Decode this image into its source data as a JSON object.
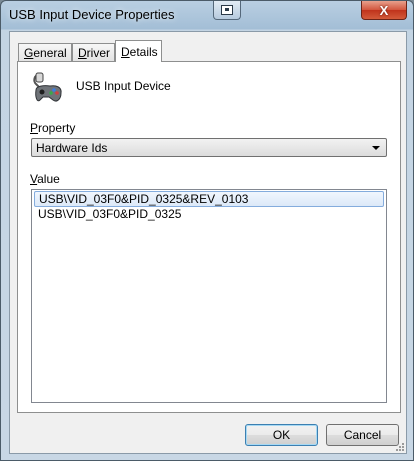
{
  "window": {
    "title": "USB Input Device Properties",
    "close_glyph": "X"
  },
  "tabs": [
    {
      "label": "General",
      "mnemonic_index": 0,
      "active": false
    },
    {
      "label": "Driver",
      "mnemonic_index": 0,
      "active": false
    },
    {
      "label": "Details",
      "mnemonic_index": 0,
      "active": true
    }
  ],
  "device": {
    "name": "USB Input Device",
    "icon": "game-controller-icon"
  },
  "property": {
    "label": "Property",
    "selected": "Hardware Ids"
  },
  "value_list": {
    "label": "Value",
    "items": [
      "USB\\VID_03F0&PID_0325&REV_0103",
      "USB\\VID_03F0&PID_0325"
    ],
    "selected_index": 0
  },
  "buttons": {
    "ok": "OK",
    "cancel": "Cancel"
  },
  "colors": {
    "selection_border": "#84acdd",
    "default_button_border": "#3c7fb1",
    "close_button": "#c0331c"
  }
}
